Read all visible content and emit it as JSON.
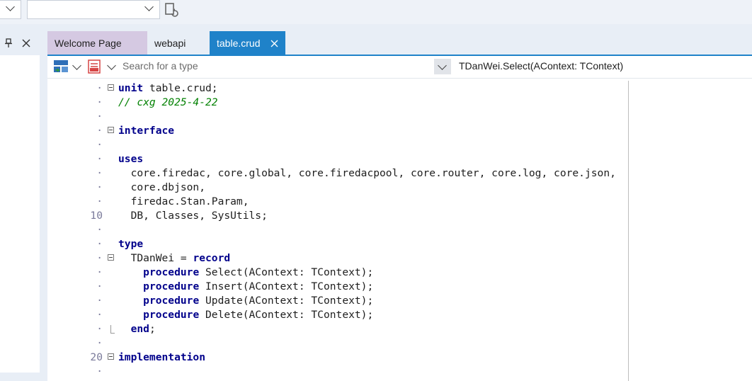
{
  "toolbar": {
    "combo_left_value": "",
    "combo_main_value": "",
    "refresh_icon": "refresh-icon"
  },
  "left_panel": {
    "pin_icon": "pin-icon",
    "close_icon": "close-icon"
  },
  "tabs": [
    {
      "label": "Welcome Page",
      "active": false
    },
    {
      "label": "webapi",
      "active": false
    },
    {
      "label": "table.crud",
      "active": true
    }
  ],
  "navbar": {
    "search_placeholder": "Search for a type",
    "member_selected": "TDanWei.Select(AContext: TContext)"
  },
  "code_lines": [
    {
      "num": "",
      "parts": [
        {
          "t": "unit",
          "c": "kw"
        },
        {
          "t": " table.crud;",
          "c": ""
        }
      ],
      "fold": "open"
    },
    {
      "num": "",
      "parts": [
        {
          "t": "// cxg 2025-4-22",
          "c": "cm"
        }
      ]
    },
    {
      "num": "",
      "parts": []
    },
    {
      "num": "",
      "parts": [
        {
          "t": "interface",
          "c": "kw"
        }
      ],
      "fold": "open"
    },
    {
      "num": "",
      "parts": []
    },
    {
      "num": "",
      "parts": [
        {
          "t": "uses",
          "c": "kw"
        }
      ]
    },
    {
      "num": "",
      "parts": [
        {
          "t": "  core.firedac, core.global, core.firedacpool, core.router, core.log, core.json,",
          "c": ""
        }
      ]
    },
    {
      "num": "",
      "parts": [
        {
          "t": "  core.dbjson,",
          "c": ""
        }
      ]
    },
    {
      "num": "",
      "parts": [
        {
          "t": "  firedac.Stan.Param,",
          "c": ""
        }
      ]
    },
    {
      "num": "10",
      "parts": [
        {
          "t": "  DB, Classes, SysUtils;",
          "c": ""
        }
      ]
    },
    {
      "num": "",
      "parts": []
    },
    {
      "num": "",
      "parts": [
        {
          "t": "type",
          "c": "kw"
        }
      ]
    },
    {
      "num": "",
      "parts": [
        {
          "t": "  TDanWei = ",
          "c": ""
        },
        {
          "t": "record",
          "c": "kw"
        }
      ],
      "fold": "open"
    },
    {
      "num": "",
      "parts": [
        {
          "t": "    ",
          "c": ""
        },
        {
          "t": "procedure",
          "c": "kw"
        },
        {
          "t": " Select(AContext: TContext);",
          "c": ""
        }
      ]
    },
    {
      "num": "",
      "parts": [
        {
          "t": "    ",
          "c": ""
        },
        {
          "t": "procedure",
          "c": "kw"
        },
        {
          "t": " Insert(AContext: TContext);",
          "c": ""
        }
      ]
    },
    {
      "num": "",
      "parts": [
        {
          "t": "    ",
          "c": ""
        },
        {
          "t": "procedure",
          "c": "kw"
        },
        {
          "t": " Update(AContext: TContext);",
          "c": ""
        }
      ]
    },
    {
      "num": "",
      "parts": [
        {
          "t": "    ",
          "c": ""
        },
        {
          "t": "procedure",
          "c": "kw"
        },
        {
          "t": " Delete(AContext: TContext);",
          "c": ""
        }
      ]
    },
    {
      "num": "",
      "parts": [
        {
          "t": "  ",
          "c": ""
        },
        {
          "t": "end",
          "c": "kw"
        },
        {
          "t": ";",
          "c": ""
        }
      ],
      "fold": "end"
    },
    {
      "num": "",
      "parts": []
    },
    {
      "num": "20",
      "parts": [
        {
          "t": "implementation",
          "c": "kw"
        }
      ],
      "fold": "open"
    },
    {
      "num": "",
      "parts": []
    }
  ]
}
